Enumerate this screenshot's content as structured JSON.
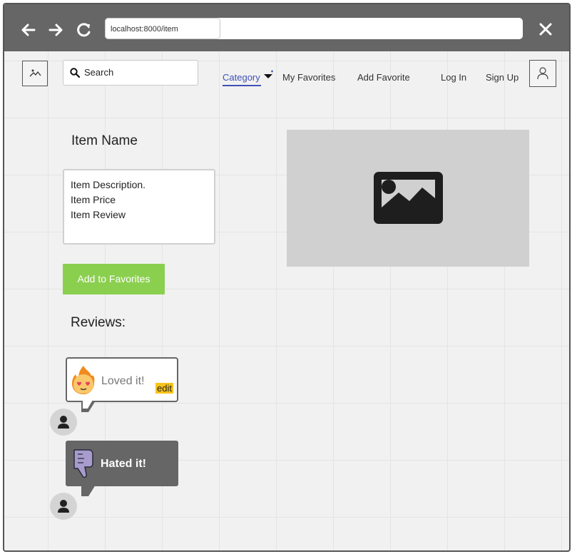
{
  "browser": {
    "url": "localhost:8000/item"
  },
  "header": {
    "search_placeholder": "Search",
    "nav": {
      "category": "Category",
      "my_favorites": "My Favorites",
      "add_favorite": "Add Favorite",
      "log_in": "Log In",
      "sign_up": "Sign Up"
    }
  },
  "item": {
    "name": "Item Name",
    "description_lines": [
      "Item Description.",
      "Item Price",
      "Item Review"
    ],
    "add_to_favorites": "Add to Favorites"
  },
  "reviews": {
    "label": "Reviews:",
    "items": [
      {
        "text": "Loved it!",
        "edit_label": "edit",
        "icon": "fire-heart-eyes-icon"
      },
      {
        "text": "Hated it!",
        "icon": "thumbs-down-icon"
      }
    ]
  },
  "colors": {
    "accent": "#3f51b5",
    "primary_button": "#8bcf4f",
    "edit_highlight": "#f7c31a",
    "titlebar": "#666666"
  }
}
